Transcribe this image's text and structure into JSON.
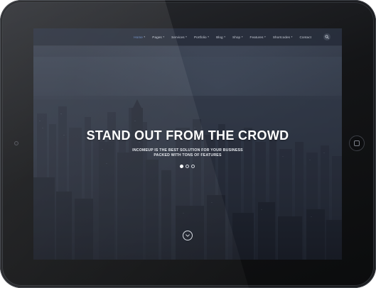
{
  "nav": {
    "items": [
      {
        "label": "Home",
        "has_dropdown": true,
        "active": true
      },
      {
        "label": "Pages",
        "has_dropdown": true,
        "active": false
      },
      {
        "label": "Services",
        "has_dropdown": true,
        "active": false
      },
      {
        "label": "Portfolio",
        "has_dropdown": true,
        "active": false
      },
      {
        "label": "Blog",
        "has_dropdown": true,
        "active": false
      },
      {
        "label": "Shop",
        "has_dropdown": true,
        "active": false
      },
      {
        "label": "Features",
        "has_dropdown": true,
        "active": false
      },
      {
        "label": "Shortcodes",
        "has_dropdown": true,
        "active": false
      },
      {
        "label": "Contact",
        "has_dropdown": false,
        "active": false
      }
    ],
    "search_icon": "search-icon",
    "active_color": "#6d8fc9"
  },
  "hero": {
    "title": "STAND OUT FROM THE CROWD",
    "subtitle_line1": "INCOMEUP IS THE BEST SOLUTION FOR YOUR BUSINESS",
    "subtitle_line2": "PACKED WITH TONS OF FEATURES",
    "slides_total": 3,
    "slide_active": 1,
    "scroll_icon": "chevron-down-icon"
  },
  "device": {
    "camera_icon": "camera-icon",
    "home_icon": "home-button-icon"
  }
}
